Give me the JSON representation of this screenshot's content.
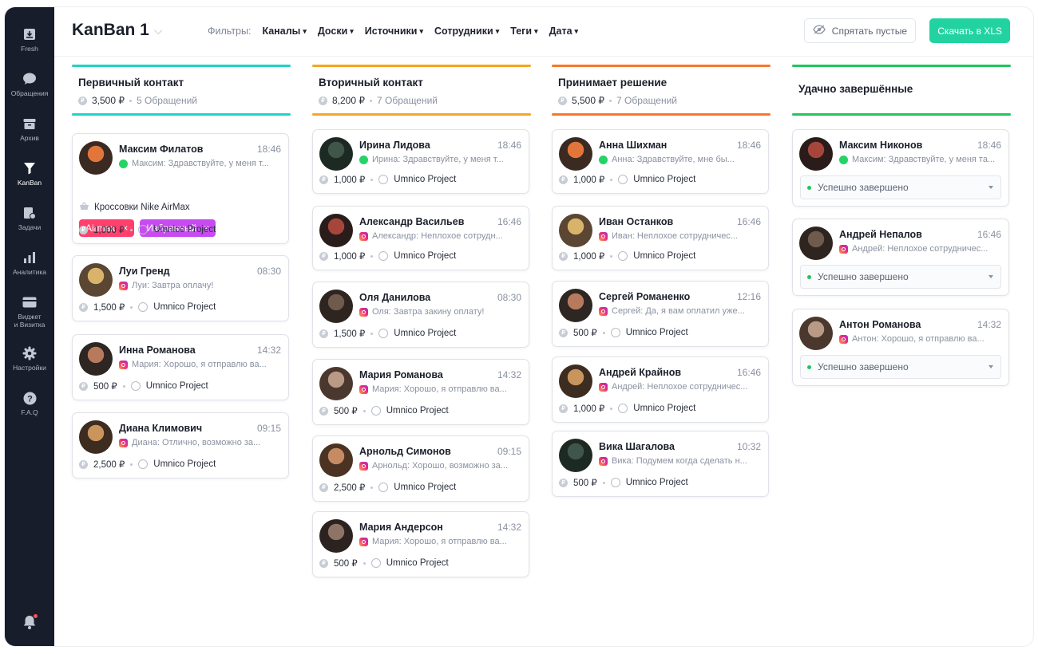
{
  "sidebar": {
    "items": [
      {
        "label": "Fresh",
        "icon": "inbox-icon"
      },
      {
        "label": "Обращения",
        "icon": "chat-bubble-icon"
      },
      {
        "label": "Архив",
        "icon": "archive-icon"
      },
      {
        "label": "KanBan",
        "icon": "funnel-icon"
      },
      {
        "label": "Задачи",
        "icon": "tasks-icon"
      },
      {
        "label": "Аналитика",
        "icon": "analytics-icon"
      },
      {
        "label": "Виджет\nи Визитка",
        "icon": "widget-icon"
      },
      {
        "label": "Настройки",
        "icon": "gear-icon"
      },
      {
        "label": "F.A.Q",
        "icon": "help-icon"
      }
    ]
  },
  "header": {
    "title": "KanBan 1",
    "filters_label": "Фильтры:",
    "filters": [
      "Каналы",
      "Доски",
      "Источники",
      "Сотрудники",
      "Теги",
      "Дата"
    ],
    "hide_empty": "Спрятать пустые",
    "download": "Скачать в XLS"
  },
  "colors": {
    "accent": "#22d3a1",
    "col1": "#22d3c5",
    "col2": "#f5a623",
    "col3": "#f5782a",
    "col4": "#22c55e"
  },
  "columns": [
    {
      "title": "Первичный контакт",
      "sum": "3,500 ₽",
      "count": "5 Обращений",
      "cards": [
        {
          "name": "Максим Филатов",
          "time": "18:46",
          "channel": "whatsapp",
          "msg": "Максим: Здравствуйте, у меня т...",
          "price": "1,000 ₽",
          "project": "Umnico Project",
          "product": "Кроссовки Nike AirMax",
          "tags": [
            "Airmax",
            "Избранный"
          ]
        },
        {
          "name": "Луи Гренд",
          "time": "08:30",
          "channel": "instagram",
          "msg": "Луи: Завтра оплачу!",
          "price": "1,500 ₽",
          "project": "Umnico Project"
        },
        {
          "name": "Инна Романова",
          "time": "14:32",
          "channel": "instagram",
          "msg": "Мария: Хорошо, я отправлю ва...",
          "price": "500 ₽",
          "project": "Umnico Project"
        },
        {
          "name": "Диана Климович",
          "time": "09:15",
          "channel": "instagram",
          "msg": "Диана: Отлично, возможно за...",
          "price": "2,500 ₽",
          "project": "Umnico Project"
        }
      ]
    },
    {
      "title": "Вторичный контакт",
      "sum": "8,200 ₽",
      "count": "7 Обращений",
      "cards": [
        {
          "name": "Ирина Лидова",
          "time": "18:46",
          "channel": "whatsapp",
          "msg": "Ирина: Здравствуйте, у меня т...",
          "price": "1,000 ₽",
          "project": "Umnico Project"
        },
        {
          "name": "Александр Васильев",
          "time": "16:46",
          "channel": "instagram",
          "msg": "Александр: Неплохое сотрудн...",
          "price": "1,000 ₽",
          "project": "Umnico Project"
        },
        {
          "name": "Оля Данилова",
          "time": "08:30",
          "channel": "instagram",
          "msg": "Оля: Завтра закину оплату!",
          "price": "1,500 ₽",
          "project": "Umnico Project"
        },
        {
          "name": "Мария Романова",
          "time": "14:32",
          "channel": "instagram",
          "msg": "Мария: Хорошо, я отправлю ва...",
          "price": "500 ₽",
          "project": "Umnico Project"
        },
        {
          "name": "Арнольд Симонов",
          "time": "09:15",
          "channel": "instagram",
          "msg": "Арнольд: Хорошо, возможно за...",
          "price": "2,500 ₽",
          "project": "Umnico Project"
        },
        {
          "name": "Мария Андерсон",
          "time": "14:32",
          "channel": "instagram",
          "msg": "Мария: Хорошо, я отправлю ва...",
          "price": "500 ₽",
          "project": "Umnico Project"
        }
      ]
    },
    {
      "title": "Принимает решение",
      "sum": "5,500 ₽",
      "count": "7 Обращений",
      "cards": [
        {
          "name": "Анна Шихман",
          "time": "18:46",
          "channel": "whatsapp",
          "msg": "Анна: Здравствуйте, мне бы...",
          "price": "1,000 ₽",
          "project": "Umnico Project"
        },
        {
          "name": "Иван Останков",
          "time": "16:46",
          "channel": "instagram",
          "msg": "Иван: Неплохое сотрудничес...",
          "price": "1,000 ₽",
          "project": "Umnico Project"
        },
        {
          "name": "Сергей Романенко",
          "time": "12:16",
          "channel": "instagram",
          "msg": "Сергей: Да, я вам оплатил уже...",
          "price": "500 ₽",
          "project": "Umnico Project"
        },
        {
          "name": "Андрей Крайнов",
          "time": "16:46",
          "channel": "instagram",
          "msg": "Андрей: Неплохое сотрудничес...",
          "price": "1,000 ₽",
          "project": "Umnico Project"
        },
        {
          "name": "Вика Шагалова",
          "time": "10:32",
          "channel": "instagram",
          "msg": "Вика: Подумем когда сделать н...",
          "price": "500 ₽",
          "project": "Umnico Project"
        }
      ]
    },
    {
      "title": "Удачно завершённые",
      "cards": [
        {
          "name": "Максим Никонов",
          "time": "18:46",
          "channel": "whatsapp",
          "msg": "Максим: Здравствуйте, у меня та...",
          "status": "Успешно завершено"
        },
        {
          "name": "Андрей Непалов",
          "time": "16:46",
          "channel": "instagram",
          "msg": "Андрей: Неплохое сотрудничес...",
          "status": "Успешно завершено"
        },
        {
          "name": "Антон Романова",
          "time": "14:32",
          "channel": "instagram",
          "msg": "Антон: Хорошо, я отправлю ва...",
          "status": "Успешно завершено"
        }
      ]
    }
  ]
}
